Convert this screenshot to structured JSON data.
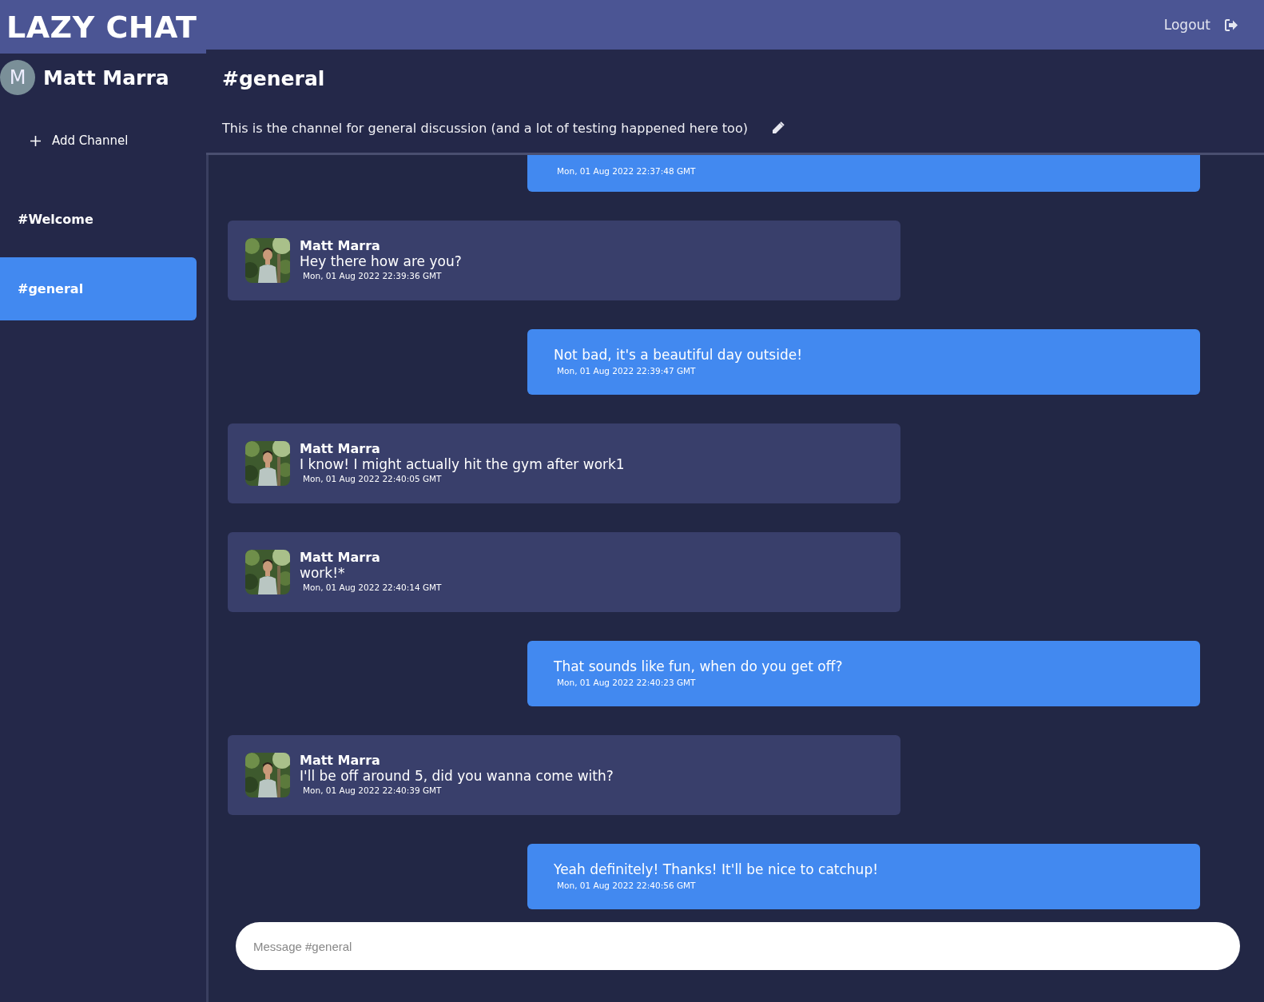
{
  "app_title": "LAZY CHAT",
  "logout": {
    "label": "Logout"
  },
  "user": {
    "initial": "M",
    "name": "Matt Marra"
  },
  "add_channel": {
    "label": "Add Channel"
  },
  "channels": [
    {
      "label": "#Welcome",
      "selected": false
    },
    {
      "label": "#general",
      "selected": true
    }
  ],
  "channel": {
    "title": "#general",
    "description": "This is the channel for general discussion (and a lot of testing happened here too)"
  },
  "messages": [
    {
      "kind": "sent",
      "time": "Mon, 01 Aug 2022 22:37:48 GMT",
      "clipped": true
    },
    {
      "kind": "received",
      "author": "Matt Marra",
      "text": "Hey there how are you?",
      "time": "Mon, 01 Aug 2022 22:39:36 GMT"
    },
    {
      "kind": "sent",
      "text": "Not bad, it's a beautiful day outside!",
      "time": "Mon, 01 Aug 2022 22:39:47 GMT"
    },
    {
      "kind": "received",
      "author": "Matt Marra",
      "text": "I know! I might actually hit the gym after work1",
      "time": "Mon, 01 Aug 2022 22:40:05 GMT"
    },
    {
      "kind": "received",
      "author": "Matt Marra",
      "text": "work!*",
      "time": "Mon, 01 Aug 2022 22:40:14 GMT"
    },
    {
      "kind": "sent",
      "text": "That sounds like fun, when do you get off?",
      "time": "Mon, 01 Aug 2022 22:40:23 GMT"
    },
    {
      "kind": "received",
      "author": "Matt Marra",
      "text": "I'll be off around 5, did you wanna come with?",
      "time": "Mon, 01 Aug 2022 22:40:39 GMT"
    },
    {
      "kind": "sent",
      "text": "Yeah definitely! Thanks! It'll be nice to catchup!",
      "time": "Mon, 01 Aug 2022 22:40:56 GMT"
    }
  ],
  "composer": {
    "placeholder": "Message #general"
  }
}
